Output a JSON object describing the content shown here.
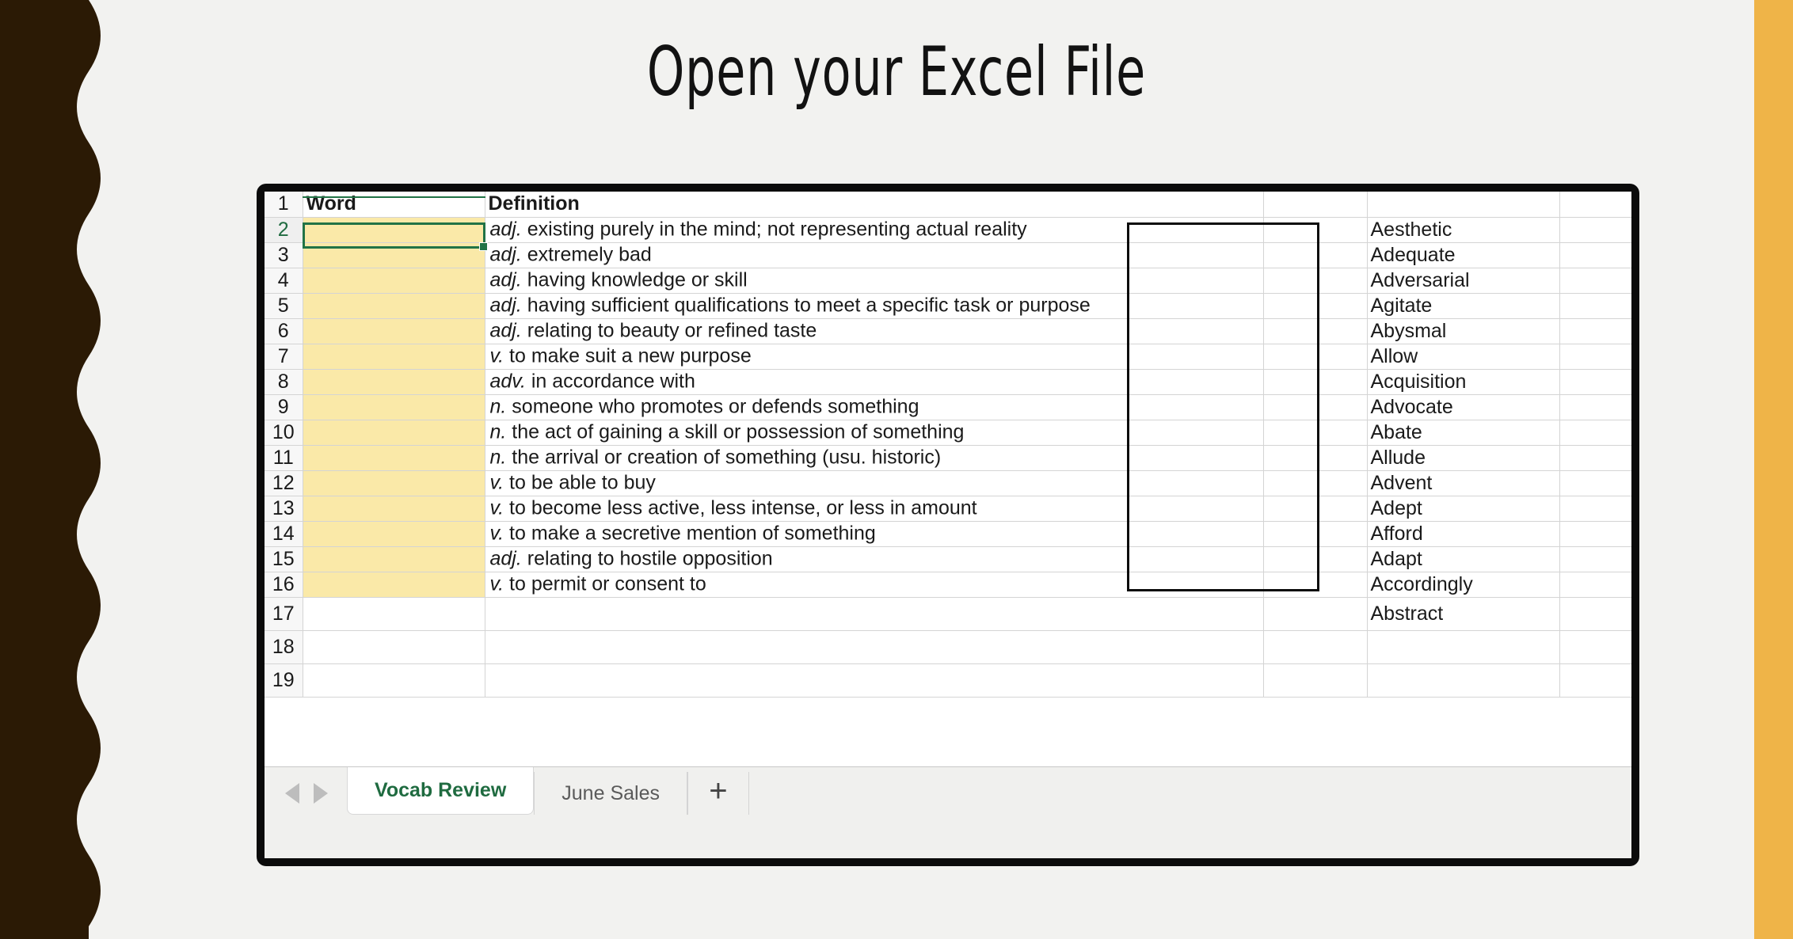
{
  "slide": {
    "title": "Open your Excel File",
    "background_color": "#F2F2F0",
    "left_edge_color": "#2B1A05",
    "right_band_color": "#EFB448"
  },
  "spreadsheet": {
    "accent_color": "#217346",
    "fill_color": "#FAE9A8",
    "selected_cell": "A2",
    "columns": {
      "a_header": "Word",
      "b_header": "Definition"
    },
    "rows": [
      {
        "num": "1",
        "word": "",
        "pos": "",
        "definition": ""
      },
      {
        "num": "2",
        "word": "",
        "pos": "adj.",
        "definition": "existing purely in the mind; not representing actual reality"
      },
      {
        "num": "3",
        "word": "",
        "pos": "adj.",
        "definition": "extremely bad"
      },
      {
        "num": "4",
        "word": "",
        "pos": "adj.",
        "definition": "having knowledge or skill"
      },
      {
        "num": "5",
        "word": "",
        "pos": "adj.",
        "definition": "having sufficient qualifications to meet a specific task or purpose"
      },
      {
        "num": "6",
        "word": "",
        "pos": "adj.",
        "definition": "relating to beauty or refined taste"
      },
      {
        "num": "7",
        "word": "",
        "pos": "v.",
        "definition": "to make suit a new purpose"
      },
      {
        "num": "8",
        "word": "",
        "pos": "adv.",
        "definition": "in accordance with"
      },
      {
        "num": "9",
        "word": "",
        "pos": "n.",
        "definition": "someone who promotes or defends something"
      },
      {
        "num": "10",
        "word": "",
        "pos": "n.",
        "definition": "the act of gaining a skill or possession of something"
      },
      {
        "num": "11",
        "word": "",
        "pos": "n.",
        "definition": "the arrival or creation of something (usu. historic)"
      },
      {
        "num": "12",
        "word": "",
        "pos": "v.",
        "definition": "to be able to buy"
      },
      {
        "num": "13",
        "word": "",
        "pos": "v.",
        "definition": "to become less active, less intense, or less in amount"
      },
      {
        "num": "14",
        "word": "",
        "pos": "v.",
        "definition": "to make a secretive mention of something"
      },
      {
        "num": "15",
        "word": "",
        "pos": "adj.",
        "definition": "relating to hostile opposition"
      },
      {
        "num": "16",
        "word": "",
        "pos": "v.",
        "definition": "to permit or consent to"
      },
      {
        "num": "17",
        "word": "",
        "pos": "",
        "definition": ""
      },
      {
        "num": "18",
        "word": "",
        "pos": "",
        "definition": ""
      },
      {
        "num": "19",
        "word": "",
        "pos": "",
        "definition": ""
      }
    ],
    "word_bank": [
      "Aesthetic",
      "Adequate",
      "Adversarial",
      "Agitate",
      "Abysmal",
      "Allow",
      "Acquisition",
      "Advocate",
      "Abate",
      "Allude",
      "Advent",
      "Adept",
      "Afford",
      "Adapt",
      "Accordingly",
      "Abstract"
    ],
    "tabs": {
      "prev_label": "◀",
      "next_label": "▶",
      "sheets": [
        {
          "name": "Vocab Review",
          "active": true
        },
        {
          "name": "June Sales",
          "active": false
        }
      ],
      "add_label": "+"
    }
  }
}
